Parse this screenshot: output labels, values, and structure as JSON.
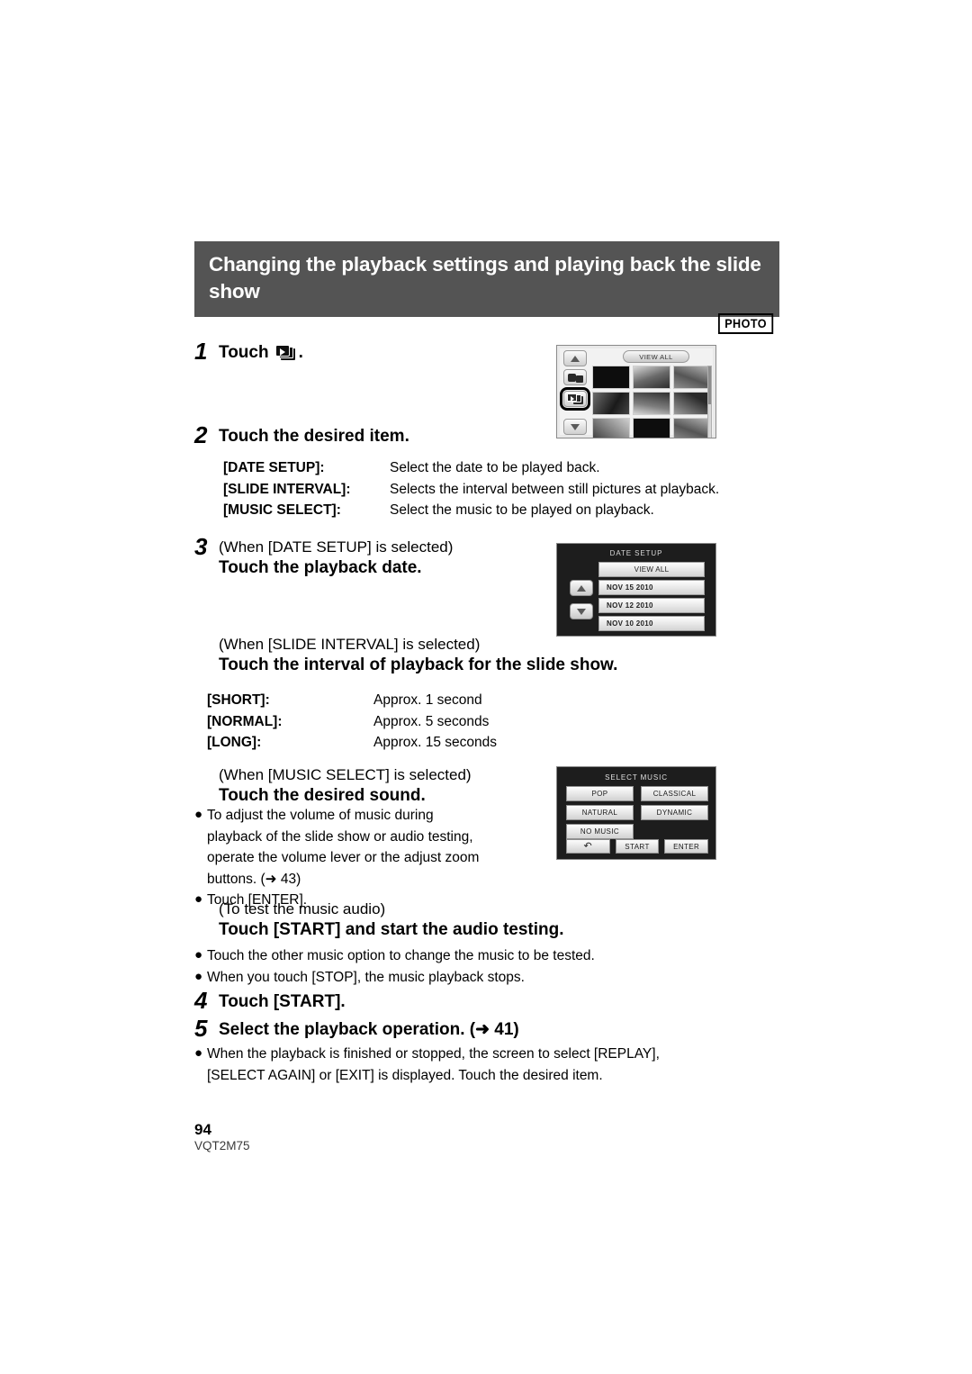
{
  "header": {
    "title": "Changing the playback settings and playing back the slide show",
    "badge": "PHOTO"
  },
  "steps": {
    "s1": {
      "num": "1",
      "label": "Touch",
      "icon": "slideshow-icon",
      "trailing": "."
    },
    "s2": {
      "num": "2",
      "head": "Touch the desired item."
    },
    "s3": {
      "num": "3",
      "pre": "(When [DATE SETUP] is selected)",
      "head": "Touch the playback date."
    },
    "s3b": {
      "pre": "(When [SLIDE INTERVAL] is selected)",
      "head": "Touch the interval of playback for the slide show."
    },
    "s3c": {
      "pre": "(When [MUSIC SELECT] is selected)",
      "head": "Touch the desired sound."
    },
    "s3d": {
      "pre": "(To test the music audio)",
      "head": "Touch [START] and start the audio testing."
    },
    "s4": {
      "num": "4",
      "head": "Touch [START]."
    },
    "s5": {
      "num": "5",
      "head": "Select the playback operation. (➜ 41)"
    }
  },
  "item_table": [
    {
      "term": "[DATE SETUP]:",
      "desc": "Select the date to be played back."
    },
    {
      "term": "[SLIDE INTERVAL]:",
      "desc": "Selects the interval between still pictures at playback."
    },
    {
      "term": "[MUSIC SELECT]:",
      "desc": "Select the music to be played on playback."
    }
  ],
  "interval_table": [
    {
      "term": "[SHORT]:",
      "desc": "Approx. 1 second"
    },
    {
      "term": "[NORMAL]:",
      "desc": "Approx. 5 seconds"
    },
    {
      "term": "[LONG]:",
      "desc": "Approx. 15 seconds"
    }
  ],
  "music_bullets": [
    "To adjust the volume of music during playback of the slide show or audio testing, operate the volume lever or the adjust zoom buttons. (➜ 43)",
    "Touch [ENTER]."
  ],
  "audio_bullets": [
    "Touch the other music option to change the music to be tested.",
    "When you touch [STOP], the music playback stops."
  ],
  "step5_bullets": [
    "When the playback is finished or stopped, the screen to select [REPLAY], [SELECT AGAIN] or [EXIT] is displayed. Touch the desired item."
  ],
  "lcd_thumbs": {
    "view_all": "VIEW ALL",
    "buttons": {
      "up": "scroll-up",
      "mode": "photo-video-mode",
      "slideshow": "slideshow",
      "down": "scroll-down"
    }
  },
  "lcd_date": {
    "title": "DATE SETUP",
    "view_all": "VIEW ALL",
    "dates": [
      "NOV 15 2010",
      "NOV 12 2010",
      "NOV 10 2010"
    ]
  },
  "lcd_music": {
    "title": "SELECT MUSIC",
    "options": [
      "POP",
      "CLASSICAL",
      "NATURAL",
      "DYNAMIC",
      "NO MUSIC"
    ],
    "bottom": {
      "back": "↶",
      "start": "START",
      "enter": "ENTER"
    }
  },
  "footer": {
    "page": "94",
    "code": "VQT2M75"
  },
  "colors": {
    "header_bar": "#545454",
    "text": "#000000",
    "lcd_bg": "#1d1d1d"
  }
}
